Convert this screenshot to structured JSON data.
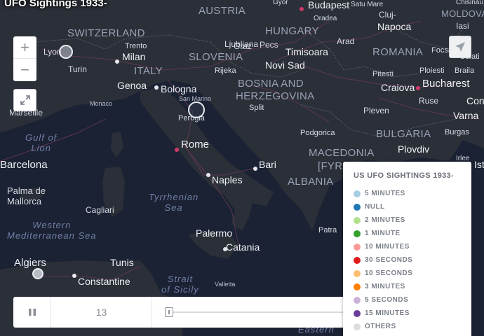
{
  "title": "UFO Sightings 1933-",
  "map": {
    "countries": [
      "AUSTRIA",
      "SWITZERLAND",
      "HUNGARY",
      "ITALY",
      "SLOVENIA",
      "ROMANIA",
      "MOLDOVA",
      "BOSNIA AND",
      "HERZEGOVINA",
      "BULGARIA",
      "MACEDONIA",
      "[FYR",
      "ALBANIA"
    ],
    "cities": [
      "Budapest",
      "Graz",
      "Cluj-",
      "Napoca",
      "Iasi",
      "Lyon",
      "Milan",
      "Ljubljana",
      "Pecs",
      "Arad",
      "Timisoara",
      "Turin",
      "Trento",
      "Rijeka",
      "Novi Sad",
      "Pitesti",
      "Ploiesti",
      "Braila",
      "Genoa",
      "Bologna",
      "Craiova",
      "Bucharest",
      "Ruse",
      "Marseille",
      "Monaco",
      "San Marino",
      "Perugia",
      "Split",
      "Pleven",
      "Varna",
      "Con",
      "Burgas",
      "Plovdiv",
      "Podgorica",
      "Rome",
      "Bari",
      "Barcelona",
      "Naples",
      "Palma de",
      "Mallorca",
      "Cagliari",
      "Patra",
      "Palermo",
      "Catania",
      "Algiers",
      "Tunis",
      "Constantine",
      "Valletta",
      "Gyor",
      "Oradea",
      "Satu Mare",
      "Chisinau",
      "Focsan",
      "Galati",
      "Irlee",
      "Istanbu"
    ],
    "seas": {
      "gulf": [
        "Gulf of",
        "Lion"
      ],
      "tyrrhenian": [
        "Tyrrhenian",
        "Sea"
      ],
      "western_med": [
        "Western",
        "Mediterranean Sea"
      ],
      "strait": [
        "Strait",
        "of Sicily"
      ],
      "eastern": "Eastern"
    }
  },
  "controls": {
    "zoom_in": "+",
    "zoom_out": "−",
    "fullscreen_icon": "fullscreen-icon",
    "locate_icon": "navigation-arrow-icon"
  },
  "timeline": {
    "step": "13",
    "progress": 0.0
  },
  "legend": {
    "title": "US UFO SIGHTINGS 1933-",
    "items": [
      {
        "label": "5 MINUTES",
        "color": "#a6cee3"
      },
      {
        "label": "NULL",
        "color": "#1f78b4"
      },
      {
        "label": "2 MINUTES",
        "color": "#b2df8a"
      },
      {
        "label": "1 MINUTE",
        "color": "#33a02c"
      },
      {
        "label": "10 MINUTES",
        "color": "#fb9a99"
      },
      {
        "label": "30 SECONDS",
        "color": "#e31a1c"
      },
      {
        "label": "10 SECONDS",
        "color": "#fdbf6f"
      },
      {
        "label": "3 MINUTES",
        "color": "#ff7f00"
      },
      {
        "label": "5 SECONDS",
        "color": "#cab2d6"
      },
      {
        "label": "15 MINUTES",
        "color": "#6a3d9a"
      },
      {
        "label": "OTHERS",
        "color": "#dddddd"
      }
    ]
  }
}
